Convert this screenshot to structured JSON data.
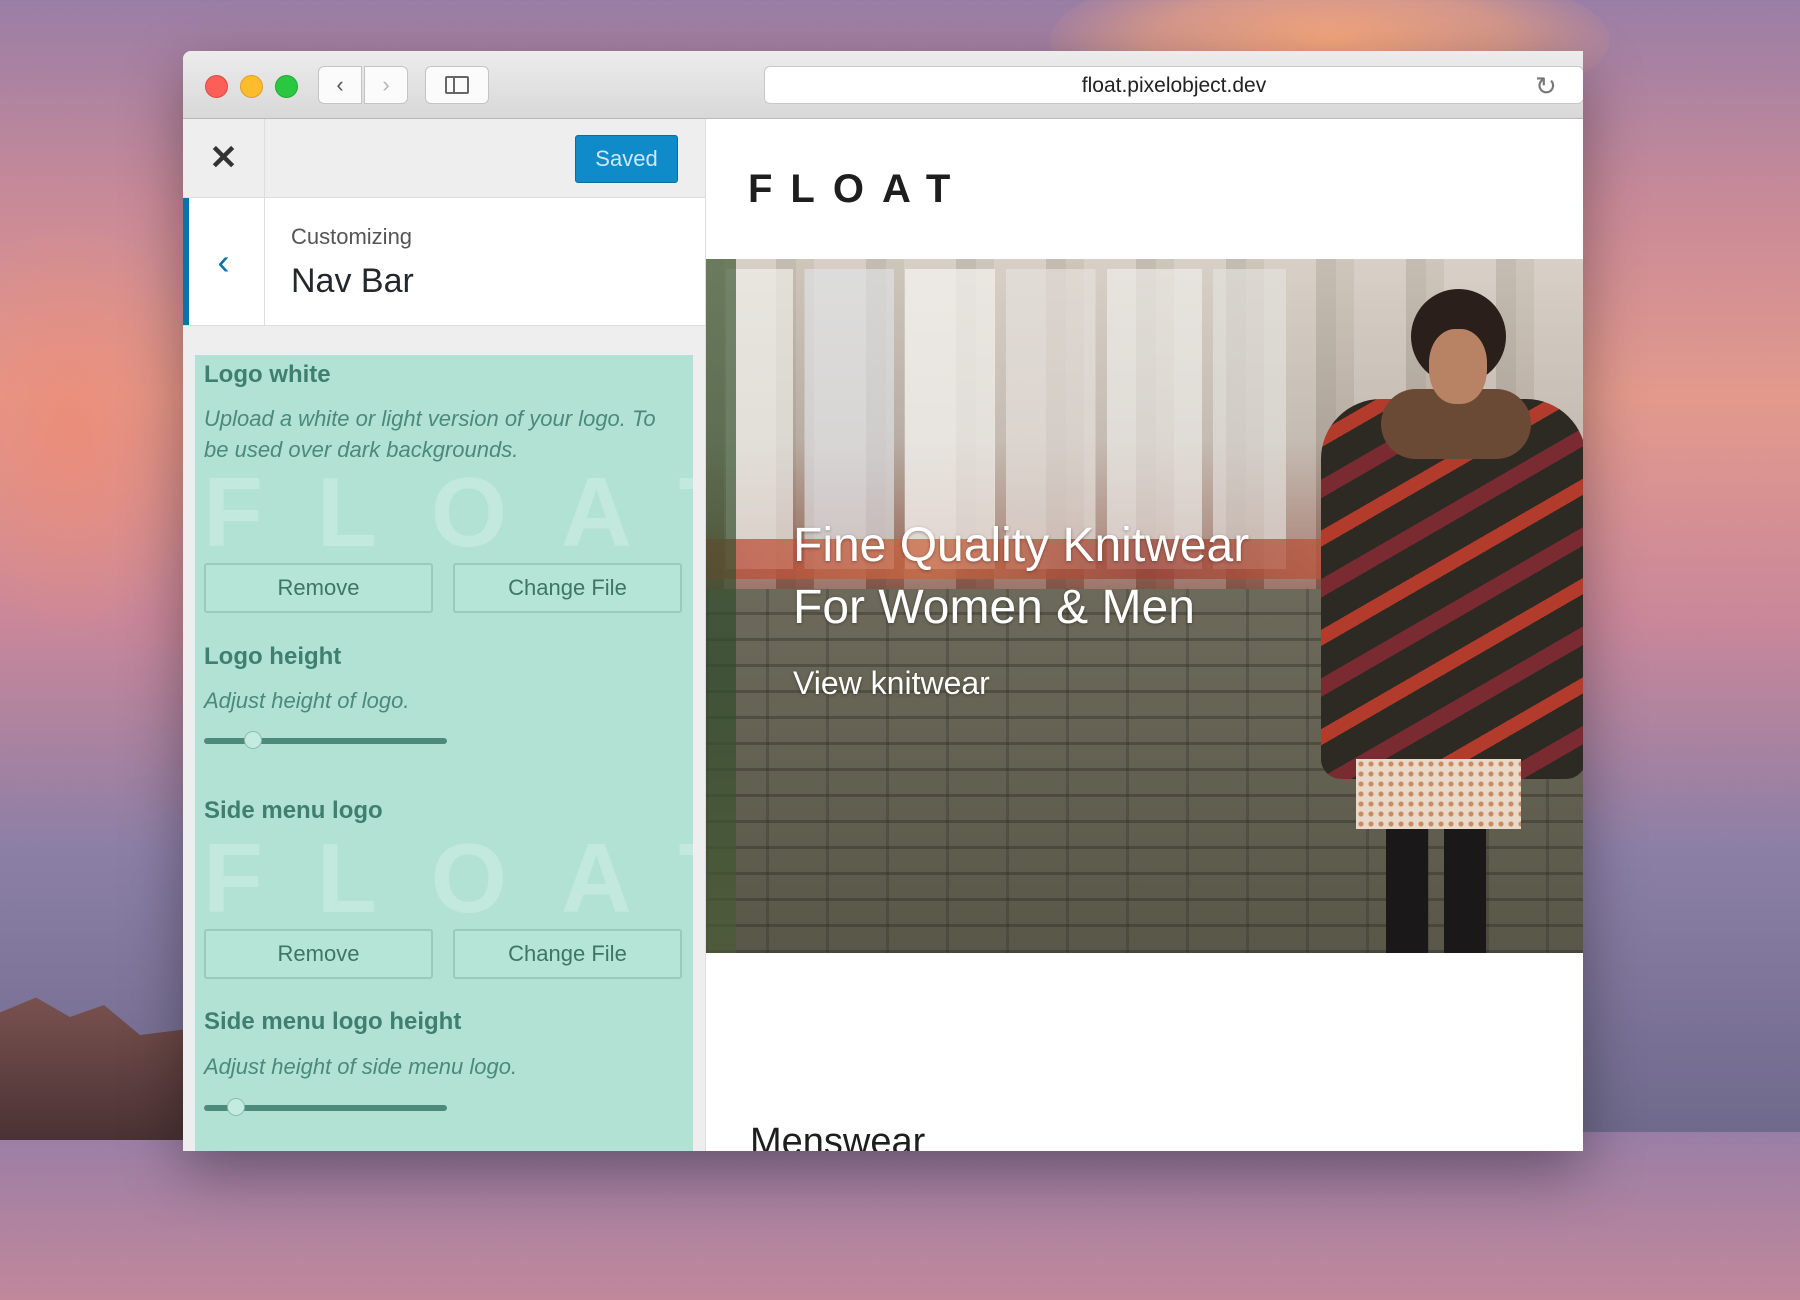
{
  "browser": {
    "url": "float.pixelobject.dev"
  },
  "customizer": {
    "saved_label": "Saved",
    "crumb": "Customizing",
    "section_title": "Nav Bar",
    "controls": {
      "logo_white": {
        "title": "Logo white",
        "description": "Upload a white or light version of your logo. To be used over dark backgrounds.",
        "preview_text": "FLOAT",
        "remove_label": "Remove",
        "change_label": "Change File"
      },
      "logo_height": {
        "title": "Logo height",
        "description": "Adjust height of logo.",
        "value_fraction": 0.2
      },
      "side_menu_logo": {
        "title": "Side menu logo",
        "preview_text": "FLOAT",
        "remove_label": "Remove",
        "change_label": "Change File"
      },
      "side_menu_logo_height": {
        "title": "Side menu logo height",
        "description": "Adjust height of side menu logo.",
        "value_fraction": 0.13
      }
    }
  },
  "preview": {
    "logo": "FLOAT",
    "hero": {
      "title_line1": "Fine Quality Knitwear",
      "title_line2": "For Women & Men",
      "link": "View knitwear"
    },
    "section_heading": "Menswear"
  },
  "colors": {
    "accent": "#0a73aa",
    "saved_button": "#0e8bc8",
    "controls_highlight": "#b2e2d4"
  }
}
